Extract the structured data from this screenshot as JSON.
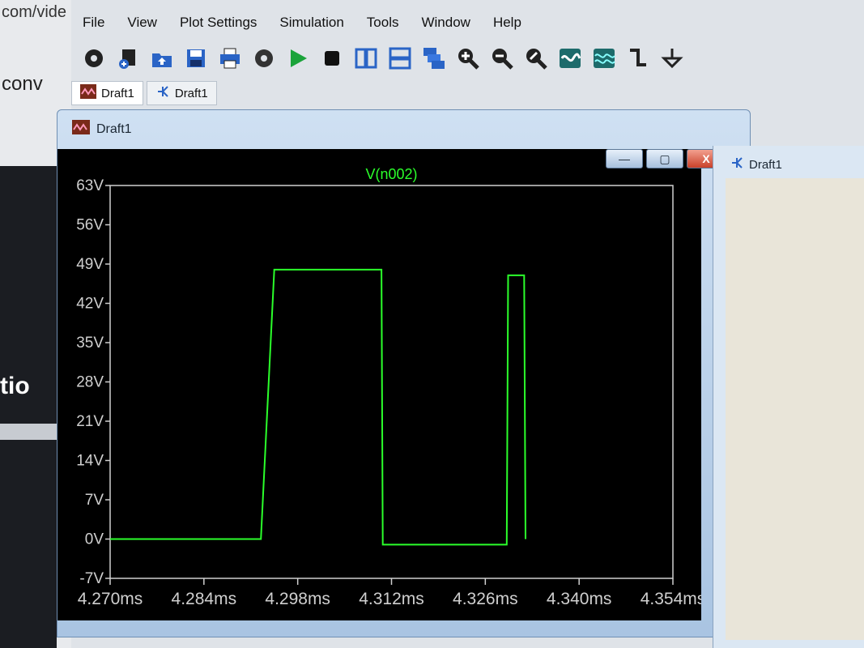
{
  "background": {
    "url_fragment": "com/vide",
    "text_conv": "conv",
    "text_tio": "tio"
  },
  "menubar": {
    "items": [
      "File",
      "View",
      "Plot Settings",
      "Simulation",
      "Tools",
      "Window",
      "Help"
    ]
  },
  "toolbar": {
    "icons": [
      "gear-icon",
      "new-schematic-icon",
      "open-icon",
      "save-icon",
      "print-icon",
      "settings-icon",
      "run-icon",
      "stop-icon",
      "tile-vertical-icon",
      "tile-horizontal-icon",
      "cascade-icon",
      "zoom-in-icon",
      "zoom-out-icon",
      "zoom-fit-icon",
      "autorange-icon",
      "plot-settings-icon",
      "wire-icon",
      "ground-icon"
    ]
  },
  "tabs": [
    {
      "label": "Draft1",
      "icon": "waveform-icon"
    },
    {
      "label": "Draft1",
      "icon": "schematic-icon"
    }
  ],
  "plot_window": {
    "title": "Draft1",
    "buttons": {
      "minimize": "—",
      "restore": "▢",
      "close": "X"
    }
  },
  "side_window": {
    "title": "Draft1"
  },
  "colors": {
    "trace": "#2bff2b",
    "axis": "#cfcfcf",
    "plot_bg": "#000000"
  },
  "chart_data": {
    "type": "line",
    "title": "V(n002)",
    "xlabel": "",
    "ylabel": "",
    "xlim": [
      4.27,
      4.354
    ],
    "ylim": [
      -7,
      63
    ],
    "x_ticks": [
      "4.270ms",
      "4.284ms",
      "4.298ms",
      "4.312ms",
      "4.326ms",
      "4.340ms",
      "4.354ms"
    ],
    "y_ticks": [
      "63V",
      "56V",
      "49V",
      "42V",
      "35V",
      "28V",
      "21V",
      "14V",
      "7V",
      "0V",
      "-7V"
    ],
    "series": [
      {
        "name": "V(n002)",
        "x": [
          4.27,
          4.2704,
          4.2923,
          4.2925,
          4.2945,
          4.3105,
          4.3107,
          4.3292,
          4.3294,
          4.3318,
          4.332
        ],
        "y": [
          0,
          0,
          0,
          0,
          48,
          48,
          -1,
          -1,
          47,
          47,
          0
        ]
      }
    ]
  }
}
